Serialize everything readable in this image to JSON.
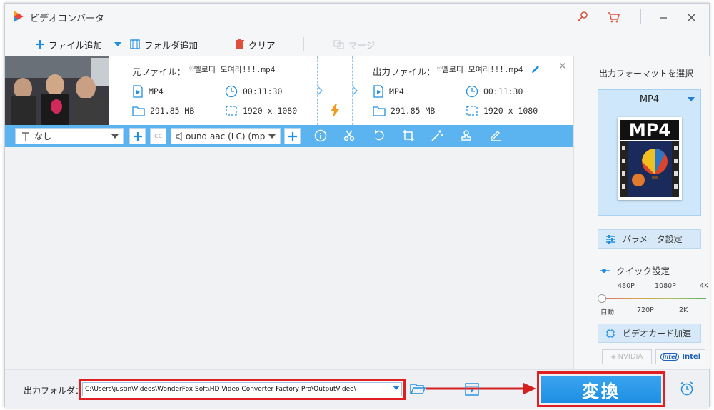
{
  "app": {
    "title": "ビデオコンバータ"
  },
  "toolbar": {
    "add_file": "ファイル追加",
    "add_folder": "フォルダ追加",
    "clear": "クリア",
    "merge": "マージ"
  },
  "file_item": {
    "source_label": "元ファイル：",
    "source_name": "♡멜로디 모여라!!!.mp4",
    "source_format": "MP4",
    "source_duration": "00:11:30",
    "source_size": "291.85 MB",
    "source_resolution": "1920 x 1080",
    "output_label": "出力ファイル：",
    "output_name": "♡멜로디 모여라!!!.mp4",
    "output_format": "MP4",
    "output_duration": "00:11:30",
    "output_size": "291.85 MB",
    "output_resolution": "1920 x 1080"
  },
  "edit_bar": {
    "subtitle_value": "なし",
    "audio_value": "ound aac (LC) (mp"
  },
  "right_panel": {
    "select_format_title": "出力フォーマットを選択",
    "format_name": "MP4",
    "format_image_text": "MP4",
    "parameter_settings": "パラメータ設定",
    "quick_settings": "クイック設定",
    "quality_top_labels": [
      "480P",
      "1080P",
      "4K"
    ],
    "quality_bottom_labels": [
      "自動",
      "720P",
      "2K"
    ],
    "quality_selected_position": 0,
    "gpu_accel": "ビデオカード加速",
    "vendor_nvidia": "NVIDIA",
    "vendor_intel": "Intel"
  },
  "bottom": {
    "output_folder_label": "出力フォルダ：",
    "output_path": "C:\\Users\\justin\\Videos\\WonderFox Soft\\HD Video Converter Factory Pro\\OutputVideo\\",
    "convert_label": "変換"
  },
  "colors": {
    "accent": "#1f8fe3",
    "highlight": "#e02020",
    "edit_bar": "#5bb4ef"
  }
}
